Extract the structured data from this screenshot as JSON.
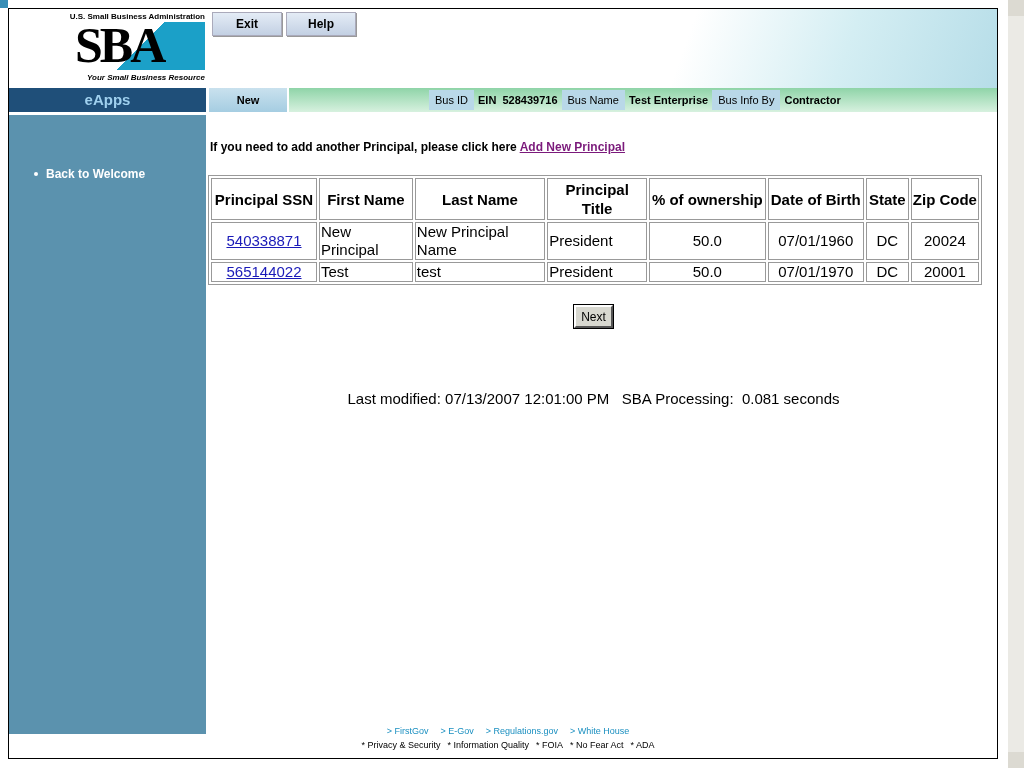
{
  "logo": {
    "agency": "U.S. Small Business Administration",
    "mark": "SBA",
    "tagline": "Your Small Business Resource"
  },
  "header_buttons": [
    "Exit",
    "Help"
  ],
  "sidebar": {
    "title": "eApps",
    "items": [
      "Back to Welcome"
    ]
  },
  "info_bar": {
    "status": "New",
    "fields": [
      {
        "label": "Bus ID",
        "value": "EIN  528439716"
      },
      {
        "label": "Bus Name",
        "value": "Test Enterprise"
      },
      {
        "label": "Bus Info By",
        "value": "Contractor"
      }
    ]
  },
  "intro": {
    "text": "If you need to add another Principal, please click here",
    "link": "Add New Principal"
  },
  "table": {
    "columns": [
      "Principal SSN",
      "First Name",
      "Last Name",
      "Principal Title",
      "% of ownership",
      "Date of Birth",
      "State",
      "Zip Code"
    ],
    "rows": [
      [
        "540338871",
        "New Principal",
        "New Principal Name",
        "President",
        "50.0",
        "07/01/1960",
        "DC",
        "20024"
      ],
      [
        "565144022",
        "Test",
        "test",
        "President",
        "50.0",
        "07/01/1970",
        "DC",
        "20001"
      ]
    ]
  },
  "next_button": "Next",
  "status_line": "Last modified: 07/13/2007 12:01:00 PM   SBA Processing:  0.081 seconds",
  "footer": {
    "links": [
      "> FirstGov",
      "> E-Gov",
      "> Regulations.gov",
      "> White House"
    ],
    "policies": [
      "* Privacy & Security",
      "* Information Quality",
      "* FOIA",
      "* No Fear Act",
      "* ADA"
    ]
  }
}
